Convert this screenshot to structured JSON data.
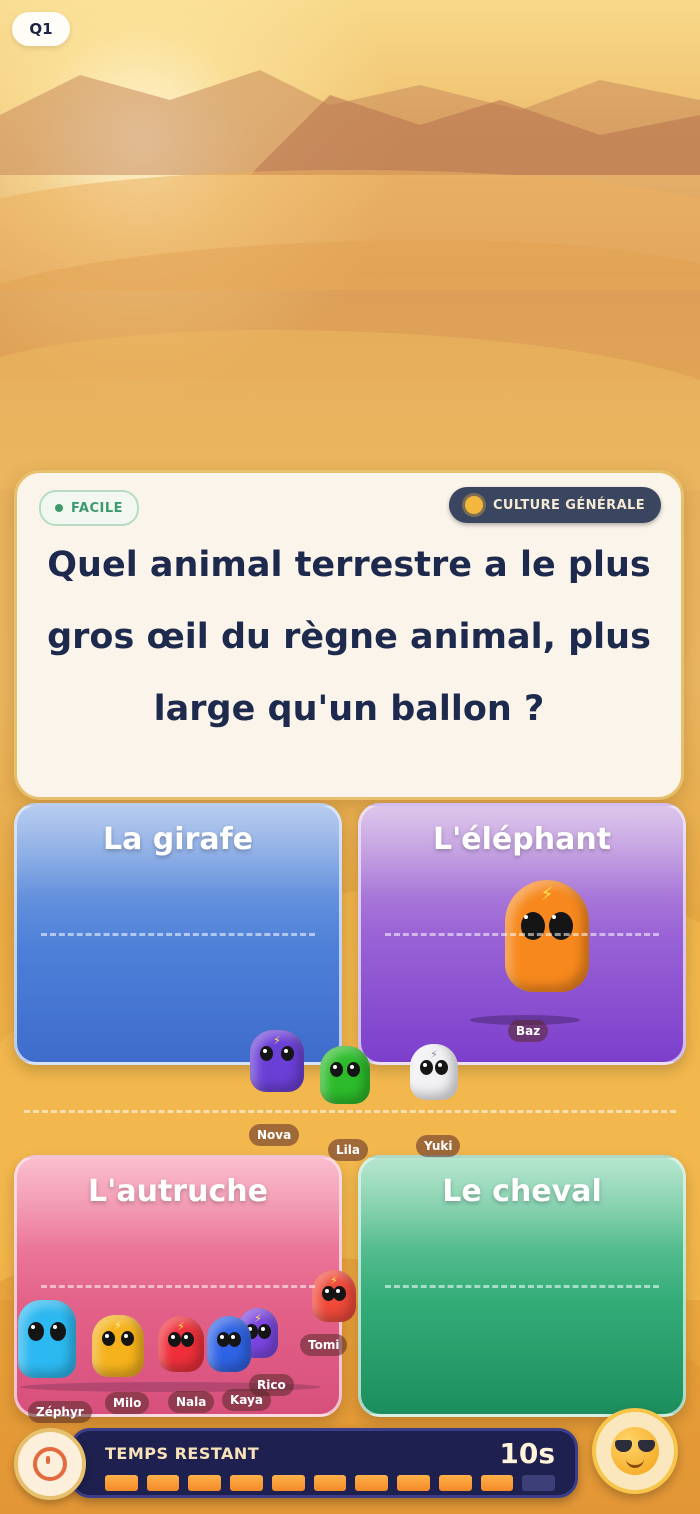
{
  "header": {
    "question_number": "Q1"
  },
  "question": {
    "difficulty": "FACILE",
    "category": "CULTURE GÉNÉRALE",
    "text": "Quel animal terrestre a le plus gros œil du règne animal, plus large qu'un ballon ?"
  },
  "answers": [
    {
      "label": "La girafe"
    },
    {
      "label": "L'éléphant"
    },
    {
      "label": "L'autruche"
    },
    {
      "label": "Le cheval"
    }
  ],
  "players": {
    "baz": "Baz",
    "nova": "Nova",
    "lila": "Lila",
    "yuki": "Yuki",
    "tomi": "Tomi",
    "zephyr": "Zéphyr",
    "milo": "Milo",
    "nala": "Nala",
    "kaya": "Kaya",
    "rico": "Rico"
  },
  "timer": {
    "label": "TEMPS RESTANT",
    "value": "10s",
    "remaining_fraction": 0.95
  },
  "colors": {
    "answer_1": "#4d80d8",
    "answer_2": "#9a63d6",
    "answer_3": "#e4638a",
    "answer_4": "#34ad79",
    "question_text": "#1d2a4d",
    "easy_badge": "#3e9a6c",
    "timer_fill": "#f28a28"
  },
  "icons": {
    "category": "sun-icon",
    "timer": "stopwatch-icon",
    "avatar": "sunglasses-emoji-icon"
  }
}
